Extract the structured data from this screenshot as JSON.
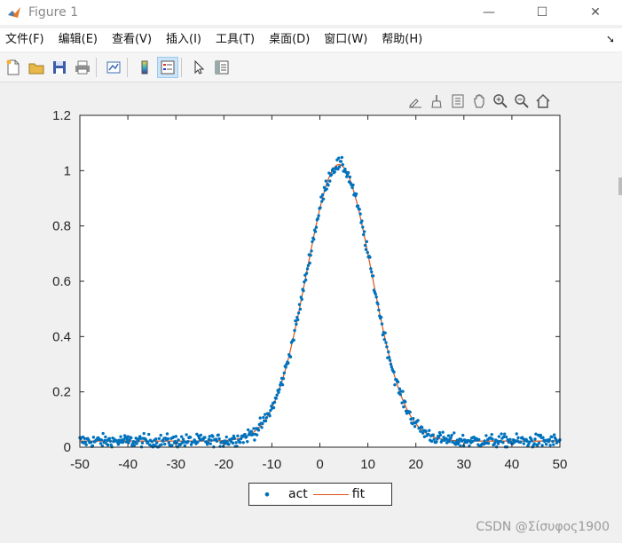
{
  "window": {
    "title": "Figure 1",
    "controls": {
      "minimize": "—",
      "maximize": "☐",
      "close": "✕"
    }
  },
  "menu": {
    "items": [
      {
        "label": "文件(F)"
      },
      {
        "label": "编辑(E)"
      },
      {
        "label": "查看(V)"
      },
      {
        "label": "插入(I)"
      },
      {
        "label": "工具(T)"
      },
      {
        "label": "桌面(D)"
      },
      {
        "label": "窗口(W)"
      },
      {
        "label": "帮助(H)"
      }
    ],
    "dock_arrow": "➘"
  },
  "toolbar": {
    "icons": [
      "new-figure-icon",
      "open-file-icon",
      "save-icon",
      "print-icon",
      "link-plot-icon",
      "colorbar-icon",
      "legend-icon",
      "edit-plot-icon",
      "property-inspector-icon"
    ]
  },
  "axes_toolbar": {
    "icons": [
      "export-icon",
      "brush-icon",
      "data-tips-icon",
      "pan-icon",
      "zoom-in-icon",
      "zoom-out-icon",
      "home-icon"
    ]
  },
  "chart_data": {
    "type": "scatter",
    "xlim": [
      -50,
      50
    ],
    "ylim": [
      0,
      1.2
    ],
    "x_ticks": [
      -50,
      -40,
      -30,
      -20,
      -10,
      0,
      10,
      20,
      30,
      40,
      50
    ],
    "y_ticks": [
      0,
      0.2,
      0.4,
      0.6,
      0.8,
      1,
      1.2
    ],
    "x_tick_labels": [
      "-50",
      "-40",
      "-30",
      "-20",
      "-10",
      "0",
      "10",
      "20",
      "30",
      "40",
      "50"
    ],
    "y_tick_labels": [
      "0",
      "0.2",
      "0.4",
      "0.6",
      "0.8",
      "1",
      "1.2"
    ],
    "grid": false,
    "legend_position": "below-axes",
    "series": [
      {
        "name": "act",
        "style": "dots",
        "color": "#0072bd",
        "model": {
          "amplitude": 1.0,
          "center": 4,
          "sigma": 6.8,
          "baseline": 0.022,
          "noise": 0.012
        },
        "x_range": [
          -50,
          50
        ],
        "points": 600
      },
      {
        "name": "fit",
        "style": "line",
        "color": "#d95319",
        "model": {
          "amplitude": 1.0,
          "center": 4,
          "sigma": 6.8,
          "baseline": 0.022
        }
      }
    ]
  },
  "legend": {
    "act": "act",
    "fit": "fit"
  },
  "watermark": "CSDN @Σίσυφος1900"
}
